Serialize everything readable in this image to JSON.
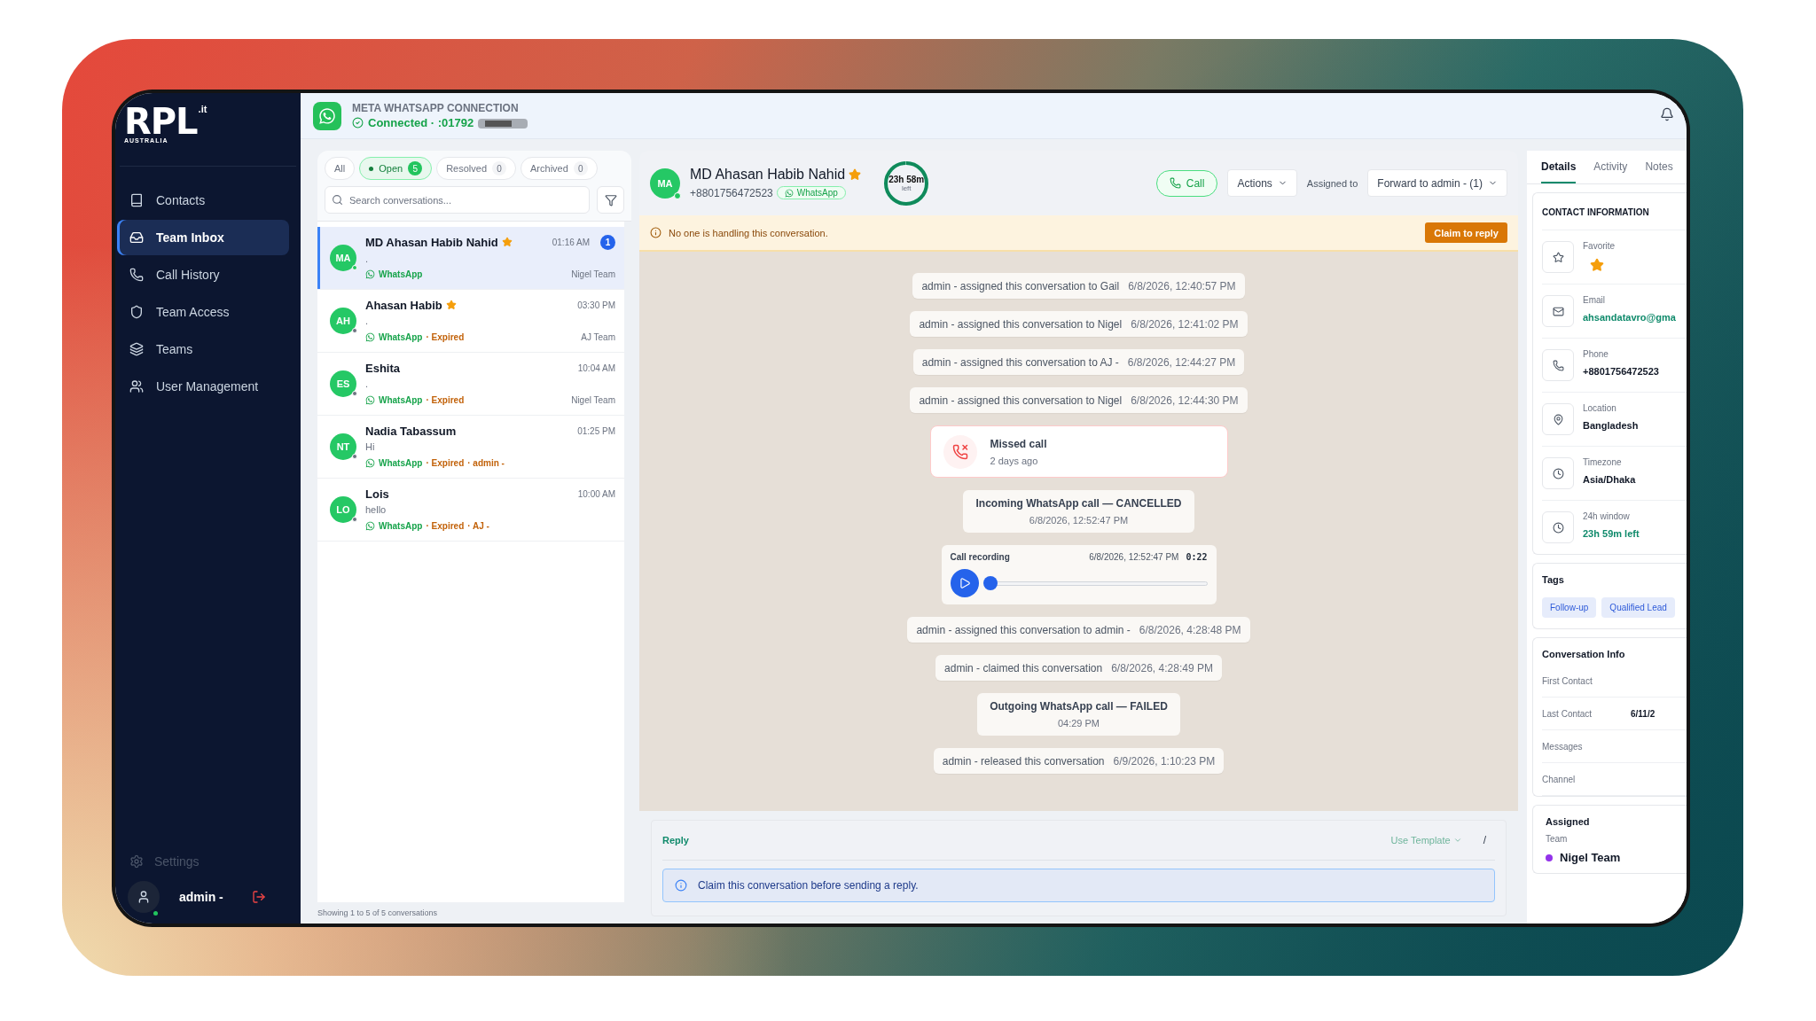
{
  "logo": {
    "text": "RPL",
    "superscript": ".it",
    "subtitle": "AUSTRALIA"
  },
  "sidebar": {
    "items": [
      {
        "label": "Contacts",
        "selected": false
      },
      {
        "label": "Team Inbox",
        "selected": true
      },
      {
        "label": "Call History",
        "selected": false
      },
      {
        "label": "Team Access",
        "selected": false
      },
      {
        "label": "Teams",
        "selected": false
      },
      {
        "label": "User Management",
        "selected": false
      }
    ],
    "settings": "Settings",
    "user": "admin -",
    "user_online": true
  },
  "connection": {
    "title": "META WHATSAPP CONNECTION",
    "status": "Connected · :01792"
  },
  "filters": [
    {
      "label": "All",
      "selected": false
    },
    {
      "label": "Open",
      "count": "5",
      "selected": true
    },
    {
      "label": "Resolved",
      "count": "0",
      "selected": false
    },
    {
      "label": "Archived",
      "count": "0",
      "selected": false
    }
  ],
  "search": {
    "placeholder": "Search conversations..."
  },
  "conversations": [
    {
      "initials": "MA",
      "name": "MD Ahasan Habib Nahid",
      "starred": true,
      "time": "01:16 AM",
      "unread": "1",
      "preview": ".",
      "channel": "WhatsApp",
      "team": "Nigel Team",
      "online": true,
      "selected": true
    },
    {
      "initials": "AH",
      "name": "Ahasan Habib",
      "starred": true,
      "time": "03:30 PM",
      "preview": ".",
      "channel": "WhatsApp",
      "meta": [
        "· Expired"
      ],
      "team": "AJ Team",
      "online": false,
      "selected": false
    },
    {
      "initials": "ES",
      "name": "Eshita",
      "starred": false,
      "time": "10:04 AM",
      "preview": ".",
      "channel": "WhatsApp",
      "meta": [
        "· Expired"
      ],
      "team": "Nigel Team",
      "online": false,
      "selected": false
    },
    {
      "initials": "NT",
      "name": "Nadia Tabassum",
      "starred": false,
      "time": "01:25 PM",
      "preview": "Hi",
      "channel": "WhatsApp",
      "meta": [
        "· Expired",
        "· admin -"
      ],
      "online": false,
      "selected": false
    },
    {
      "initials": "LO",
      "name": "Lois",
      "starred": false,
      "time": "10:00 AM",
      "preview": "hello",
      "channel": "WhatsApp",
      "meta": [
        "· Expired",
        "· AJ -"
      ],
      "online": false,
      "selected": false
    }
  ],
  "list_footer": "Showing 1 to 5 of 5 conversations",
  "contact_header": {
    "initials": "MA",
    "name": "MD Ahasan Habib Nahid",
    "starred": true,
    "online": true,
    "phone": "+8801756472523",
    "channel": "WhatsApp",
    "timer": "23h 58m",
    "timer_sub": "left",
    "level": 0.99
  },
  "actions": {
    "call": "Call",
    "actions": "Actions",
    "assigned_label": "Assigned to",
    "assignee": "Forward to admin - (1)"
  },
  "banner": {
    "text": "No one is handling this conversation.",
    "button": "Claim to reply"
  },
  "messages": [
    {
      "kind": "event",
      "text": "admin - assigned this conversation to Gail",
      "time": "6/8/2026, 12:40:57 PM"
    },
    {
      "kind": "event",
      "text": "admin - assigned this conversation to Nigel",
      "time": "6/8/2026, 12:41:02 PM"
    },
    {
      "kind": "event",
      "text": "admin - assigned this conversation to AJ -",
      "time": "6/8/2026, 12:44:27 PM"
    },
    {
      "kind": "event",
      "text": "admin - assigned this conversation to Nigel",
      "time": "6/8/2026, 12:44:30 PM"
    },
    {
      "kind": "missed_call",
      "title": "Missed call",
      "subtitle": "2 days ago"
    },
    {
      "kind": "call_status",
      "title": "Incoming WhatsApp call — CANCELLED",
      "time": "6/8/2026, 12:52:47 PM"
    },
    {
      "kind": "recording",
      "title": "Call recording",
      "time": "6/8/2026, 12:52:47 PM",
      "duration": "0:22",
      "level": 0.02
    },
    {
      "kind": "event",
      "text": "admin - assigned this conversation to admin -",
      "time": "6/8/2026, 4:28:48 PM"
    },
    {
      "kind": "event",
      "text": "admin - claimed this conversation",
      "time": "6/8/2026, 4:28:49 PM"
    },
    {
      "kind": "call_status",
      "title": "Outgoing WhatsApp call — FAILED",
      "time": "04:29 PM"
    },
    {
      "kind": "event",
      "text": "admin - released this conversation",
      "time": "6/9/2026, 1:10:23 PM"
    }
  ],
  "reply": {
    "title": "Reply",
    "template": "Use Template",
    "shortcut": "/",
    "notice": "Claim this conversation before sending a reply."
  },
  "details_tabs": [
    {
      "label": "Details",
      "selected": true
    },
    {
      "label": "Activity",
      "selected": false
    },
    {
      "label": "Notes",
      "selected": false
    }
  ],
  "contact_info": {
    "title": "CONTACT INFORMATION",
    "fields": [
      {
        "kind": "favorite",
        "label": "Favorite",
        "favorite": true
      },
      {
        "kind": "email",
        "label": "Email",
        "value": "ahsandatavro@gma",
        "highlight": true
      },
      {
        "kind": "phone",
        "label": "Phone",
        "value": "+8801756472523",
        "highlight": false
      },
      {
        "kind": "location",
        "label": "Location",
        "value": "Bangladesh",
        "highlight": false
      },
      {
        "kind": "time",
        "label": "Timezone",
        "value": "Asia/Dhaka",
        "highlight": false
      },
      {
        "kind": "time",
        "label": "24h window",
        "value": "23h 59m left",
        "highlight": true
      }
    ]
  },
  "tags": {
    "title": "Tags",
    "items": [
      "Follow-up",
      "Qualified Lead"
    ]
  },
  "conversation_info": {
    "title": "Conversation Info",
    "rows": [
      {
        "label": "First Contact"
      },
      {
        "label": "Last Contact",
        "value": "6/11/2"
      },
      {
        "label": "Messages"
      },
      {
        "label": "Channel"
      }
    ]
  },
  "assigned": {
    "title": "Assigned",
    "label": "Team",
    "team": "Nigel Team",
    "color": "#9333ea"
  }
}
